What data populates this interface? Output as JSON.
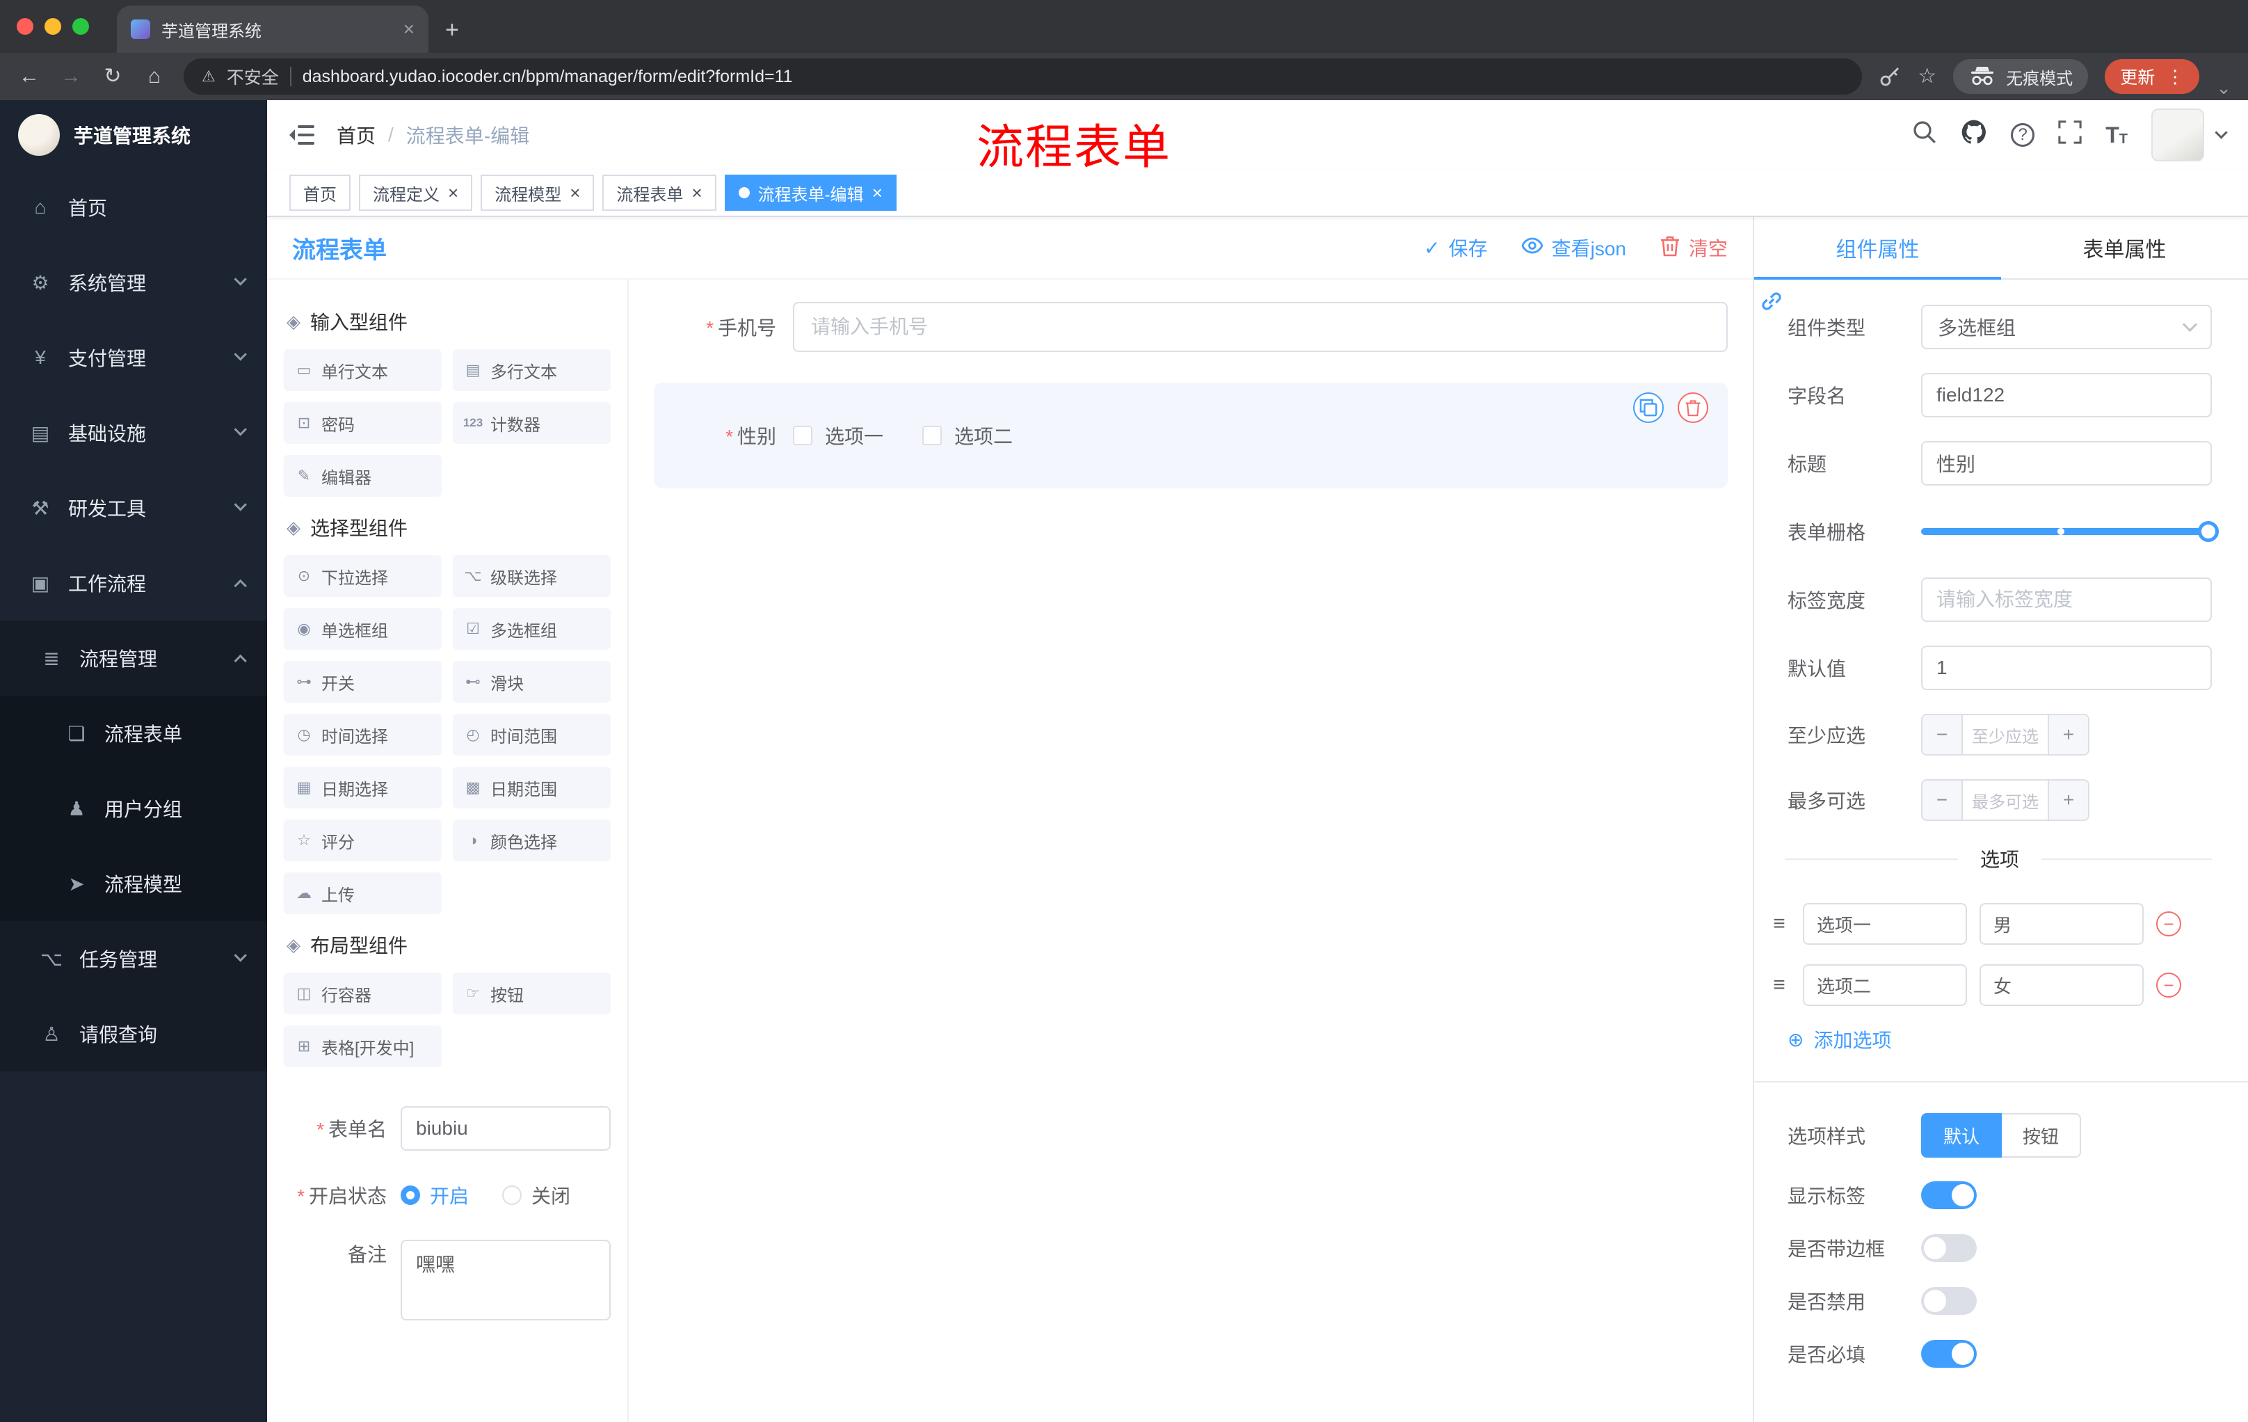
{
  "misc": {
    "required_mark": "*",
    "breadcrumb_sep": "/"
  },
  "colors": {
    "accent": "#409eff",
    "danger": "#f56c6c",
    "annotation": "#ff0000",
    "tag_active": "#409eff"
  },
  "icons": {
    "close": "×",
    "new_tab": "+",
    "back": "←",
    "forward": "→",
    "reload": "↻",
    "home_nav": "⌂",
    "warning": "⚠",
    "star": "☆",
    "menu_dots": "⋮",
    "caret_down": "⌄",
    "question": "?",
    "font_big": "T",
    "font_small": "T",
    "check": "✓",
    "home": "⌂",
    "system": "⚙",
    "payment": "¥",
    "infra": "▤",
    "devtool": "⚒",
    "workflow": "▣",
    "process_mgmt": "≣",
    "process_form": "❏",
    "user_group": "♟",
    "process_model": "➤",
    "task_mgmt": "⌥",
    "leave_query": "♙",
    "section": "◈",
    "chip_single_text": "▭",
    "chip_multi_text": "▤",
    "chip_password": "⊡",
    "chip_counter": "123",
    "chip_editor": "✎",
    "chip_select": "⊙",
    "chip_cascader": "⌥",
    "chip_radio": "◉",
    "chip_checkbox": "☑",
    "chip_switch": "⊶",
    "chip_slider": "⊷",
    "chip_time": "◷",
    "chip_time_range": "◴",
    "chip_date": "▦",
    "chip_date_range": "▩",
    "chip_rate": "☆",
    "chip_color": "◑",
    "chip_upload": "☁",
    "chip_row": "◫",
    "chip_button": "☞",
    "chip_table": "⊞",
    "add_circle": "⊕",
    "drag": "≡",
    "minus": "−",
    "plus": "+"
  },
  "browser": {
    "tab_title": "芋道管理系统",
    "security_label": "不安全",
    "url": "dashboard.yudao.iocoder.cn/bpm/manager/form/edit?formId=11",
    "incognito_label": "无痕模式",
    "update_label": "更新"
  },
  "app": {
    "title": "芋道管理系统"
  },
  "header": {
    "breadcrumb_home": "首页",
    "breadcrumb_current": "流程表单-编辑",
    "annotation": "流程表单"
  },
  "sidebar": {
    "items": [
      {
        "label": "首页"
      },
      {
        "label": "系统管理"
      },
      {
        "label": "支付管理"
      },
      {
        "label": "基础设施"
      },
      {
        "label": "研发工具"
      },
      {
        "label": "工作流程"
      },
      {
        "label": "流程管理"
      },
      {
        "label": "流程表单"
      },
      {
        "label": "用户分组"
      },
      {
        "label": "流程模型"
      },
      {
        "label": "任务管理"
      },
      {
        "label": "请假查询"
      }
    ]
  },
  "tags": {
    "items": [
      {
        "label": "首页"
      },
      {
        "label": "流程定义"
      },
      {
        "label": "流程模型"
      },
      {
        "label": "流程表单"
      },
      {
        "label": "流程表单-编辑"
      }
    ]
  },
  "designer": {
    "title": "流程表单",
    "save_label": "保存",
    "view_json_label": "查看json",
    "clear_label": "清空",
    "palette": {
      "sections": [
        {
          "title": "输入型组件",
          "items": [
            "单行文本",
            "多行文本",
            "密码",
            "计数器",
            "编辑器"
          ]
        },
        {
          "title": "选择型组件",
          "items": [
            "下拉选择",
            "级联选择",
            "单选框组",
            "多选框组",
            "开关",
            "滑块",
            "时间选择",
            "时间范围",
            "日期选择",
            "日期范围",
            "评分",
            "颜色选择",
            "上传"
          ]
        },
        {
          "title": "布局型组件",
          "items": [
            "行容器",
            "按钮",
            "表格[开发中]"
          ]
        }
      ]
    },
    "form_meta": {
      "name_label": "表单名",
      "name_value": "biubiu",
      "status_label": "开启状态",
      "status_on": "开启",
      "status_off": "关闭",
      "remark_label": "备注",
      "remark_value": "嘿嘿"
    },
    "canvas": {
      "phone_label": "手机号",
      "phone_placeholder": "请输入手机号",
      "gender_label": "性别",
      "gender_option1": "选项一",
      "gender_option2": "选项二"
    }
  },
  "properties": {
    "tab_component": "组件属性",
    "tab_form": "表单属性",
    "component_type_label": "组件类型",
    "component_type_value": "多选框组",
    "field_name_label": "字段名",
    "field_name_value": "field122",
    "title_label": "标题",
    "title_value": "性别",
    "grid_label": "表单栅格",
    "label_width_label": "标签宽度",
    "label_width_placeholder": "请输入标签宽度",
    "default_label": "默认值",
    "default_value": "1",
    "min_label": "至少应选",
    "min_placeholder": "至少应选",
    "max_label": "最多可选",
    "max_placeholder": "最多可选",
    "options_title": "选项",
    "options": [
      {
        "label": "选项一",
        "value": "男"
      },
      {
        "label": "选项二",
        "value": "女"
      }
    ],
    "add_option_label": "添加选项",
    "option_style_label": "选项样式",
    "option_style_default": "默认",
    "option_style_button": "按钮",
    "show_label_label": "显示标签",
    "border_label": "是否带边框",
    "disabled_label": "是否禁用",
    "required_label": "是否必填"
  }
}
